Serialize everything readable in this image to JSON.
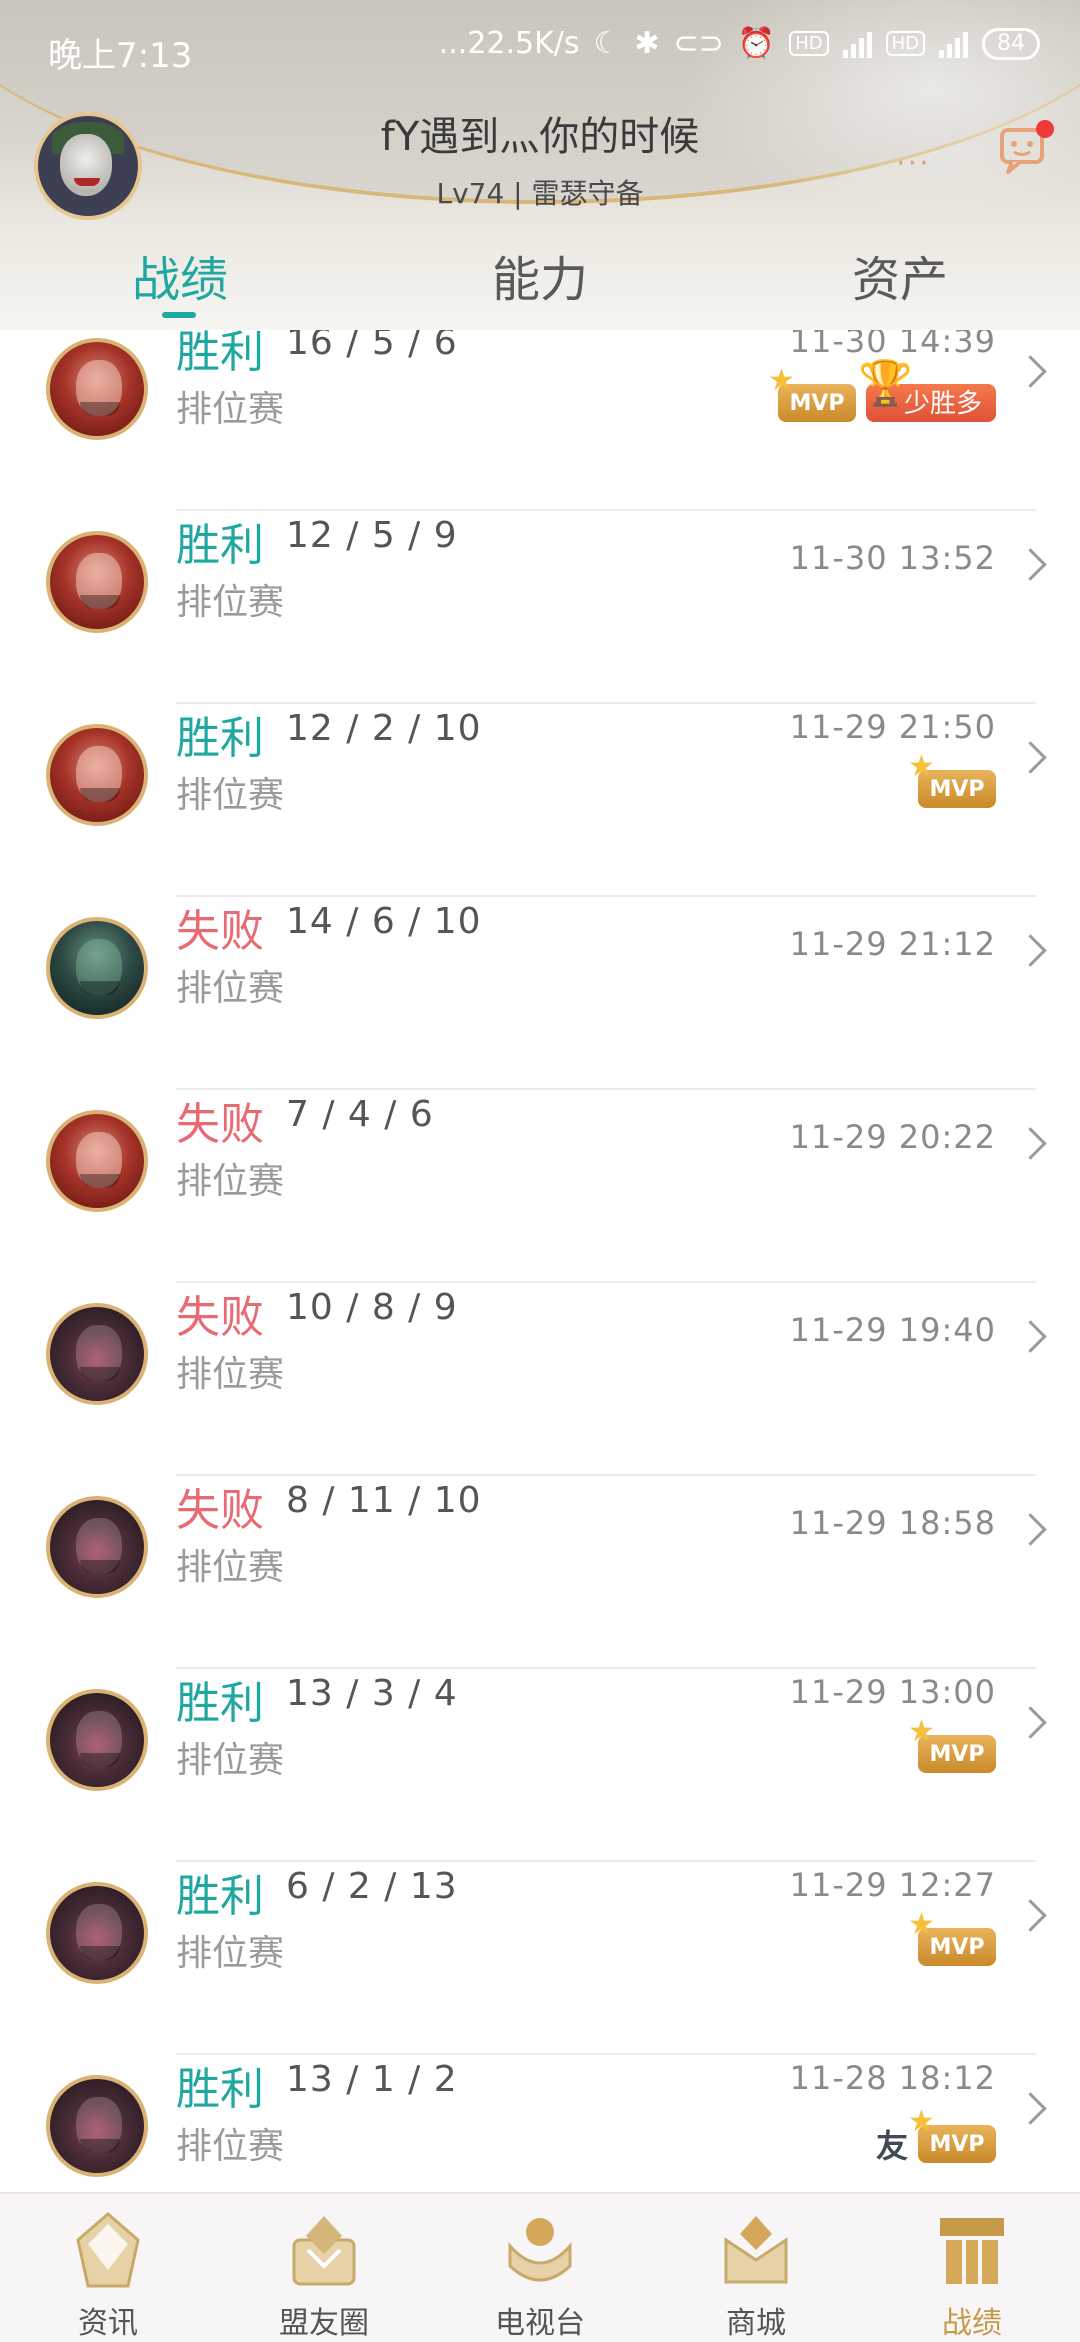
{
  "status_bar": {
    "time": "晚上7:13",
    "network_speed": "...22.5K/s",
    "hd1": "HD",
    "net1": "4G",
    "hd2": "HD",
    "net2": "4G",
    "battery": "84"
  },
  "header": {
    "username": "fY遇到灬你的时候",
    "level_line": "Lv74 | 雷瑟守备",
    "more_dots": "···"
  },
  "tabs": [
    {
      "label": "战绩",
      "active": true
    },
    {
      "label": "能力",
      "active": false
    },
    {
      "label": "资产",
      "active": false
    }
  ],
  "matches": [
    {
      "result": "胜利",
      "outcome": "win",
      "kda": "16 / 5 / 6",
      "mode": "排位赛",
      "time": "11-30 14:39",
      "hero": "red",
      "badges": [
        "MVP",
        "少胜多"
      ]
    },
    {
      "result": "胜利",
      "outcome": "win",
      "kda": "12 / 5 / 9",
      "mode": "排位赛",
      "time": "11-30 13:52",
      "hero": "red",
      "badges": []
    },
    {
      "result": "胜利",
      "outcome": "win",
      "kda": "12 / 2 / 10",
      "mode": "排位赛",
      "time": "11-29 21:50",
      "hero": "red",
      "badges": [
        "MVP"
      ]
    },
    {
      "result": "失败",
      "outcome": "lose",
      "kda": "14 / 6 / 10",
      "mode": "排位赛",
      "time": "11-29 21:12",
      "hero": "green",
      "badges": []
    },
    {
      "result": "失败",
      "outcome": "lose",
      "kda": "7 / 4 / 6",
      "mode": "排位赛",
      "time": "11-29 20:22",
      "hero": "red",
      "badges": []
    },
    {
      "result": "失败",
      "outcome": "lose",
      "kda": "10 / 8 / 9",
      "mode": "排位赛",
      "time": "11-29 19:40",
      "hero": "beast",
      "badges": []
    },
    {
      "result": "失败",
      "outcome": "lose",
      "kda": "8 / 11 / 10",
      "mode": "排位赛",
      "time": "11-29 18:58",
      "hero": "beast",
      "badges": []
    },
    {
      "result": "胜利",
      "outcome": "win",
      "kda": "13 / 3 / 4",
      "mode": "排位赛",
      "time": "11-29 13:00",
      "hero": "beast",
      "badges": [
        "MVP"
      ]
    },
    {
      "result": "胜利",
      "outcome": "win",
      "kda": "6 / 2 / 13",
      "mode": "排位赛",
      "time": "11-29 12:27",
      "hero": "beast",
      "badges": [
        "MVP"
      ]
    },
    {
      "result": "胜利",
      "outcome": "win",
      "kda": "13 / 1 / 2",
      "mode": "排位赛",
      "time": "11-28 18:12",
      "hero": "beast",
      "badges": [
        "友",
        "MVP"
      ]
    }
  ],
  "bottom_nav": [
    {
      "label": "资讯",
      "icon": "news-icon",
      "active": false
    },
    {
      "label": "盟友圈",
      "icon": "friends-icon",
      "active": false
    },
    {
      "label": "电视台",
      "icon": "tv-icon",
      "active": false
    },
    {
      "label": "商城",
      "icon": "shop-icon",
      "active": false
    },
    {
      "label": "战绩",
      "icon": "record-icon",
      "active": true
    }
  ],
  "colors": {
    "accent_teal": "#20a8a0",
    "lose_red": "#e86a72",
    "gold": "#c69a4a"
  }
}
